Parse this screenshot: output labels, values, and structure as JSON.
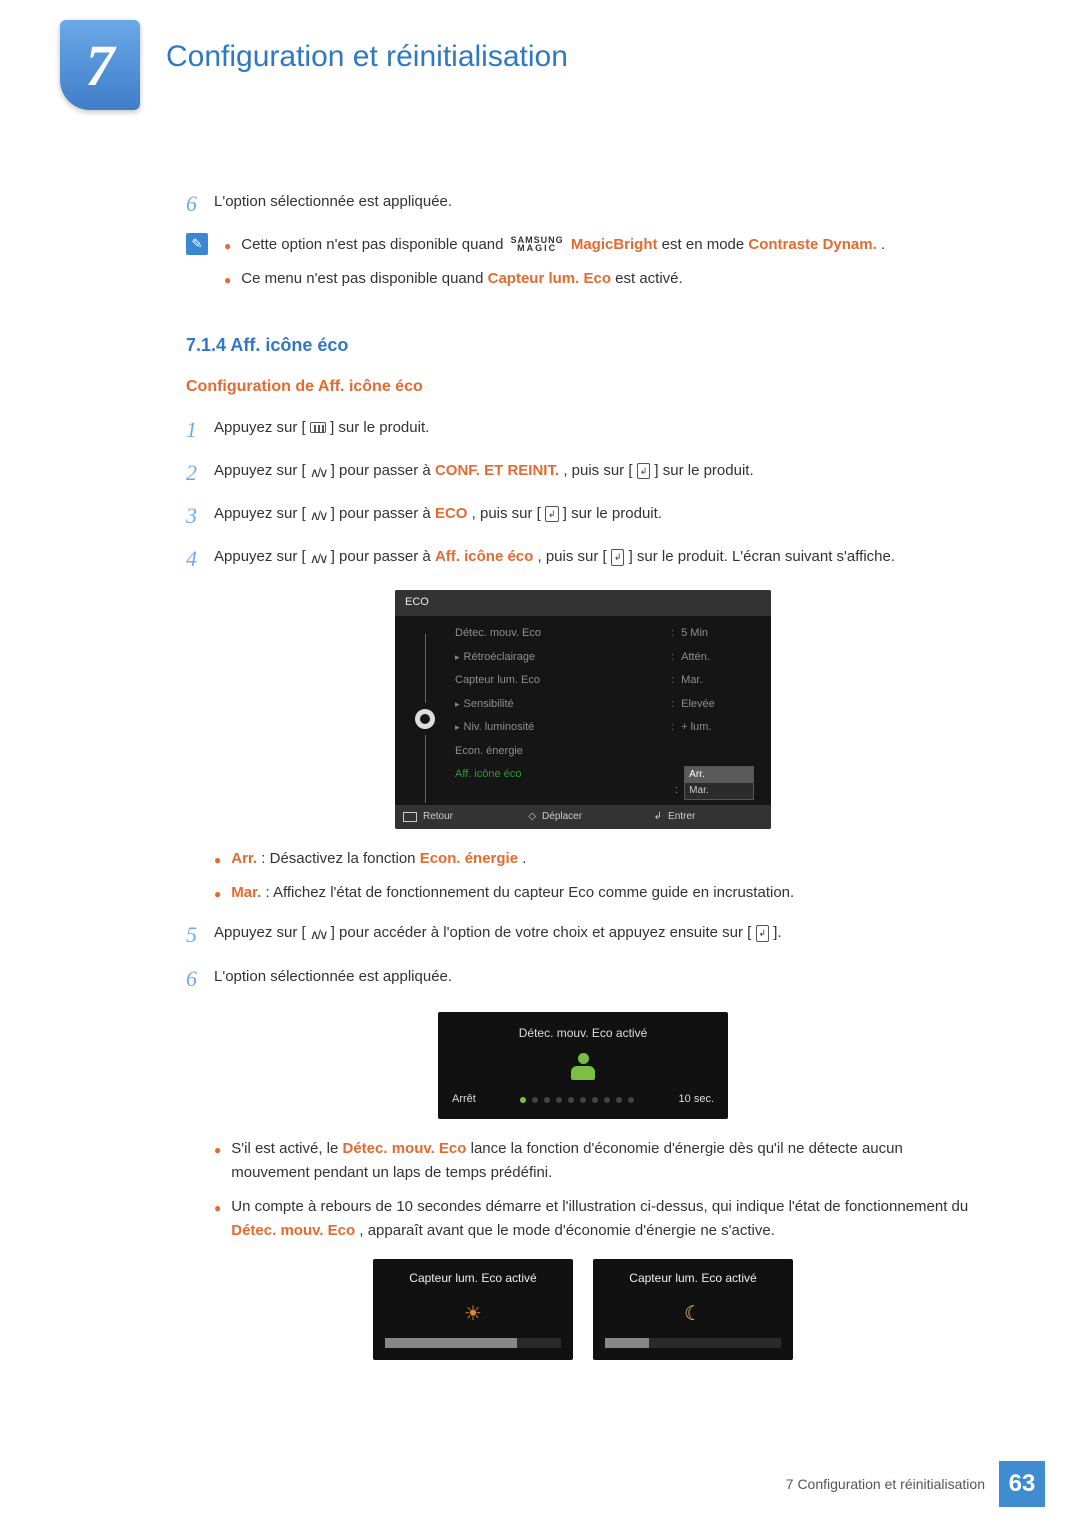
{
  "chapter": {
    "number": "7",
    "title": "Configuration et réinitialisation"
  },
  "top_step": {
    "num": "6",
    "text": "L'option sélectionnée est appliquée."
  },
  "note": {
    "bullet1_pre": "Cette option n'est pas disponible quand ",
    "bullet1_post": " est en mode ",
    "magicbright": "MagicBright",
    "dynam": "Contraste Dynam.",
    "period": ".",
    "bullet2_pre": "Ce menu n'est pas disponible quand ",
    "bullet2_hi": "Capteur lum. Eco",
    "bullet2_post": " est activé."
  },
  "magic_brand": {
    "line1": "SAMSUNG",
    "line2": "MAGIC"
  },
  "section": {
    "num_title": "7.1.4  Aff. icône éco",
    "subtitle": "Configuration de Aff. icône éco"
  },
  "steps": {
    "s1": {
      "num": "1",
      "pre": "Appuyez sur [",
      "post": "] sur le produit."
    },
    "s2": {
      "num": "2",
      "pre": "Appuyez sur [",
      "mid1": "] pour passer à ",
      "hi": "CONF. ET REINIT.",
      "mid2": ", puis sur [",
      "post": "] sur le produit."
    },
    "s3": {
      "num": "3",
      "pre": "Appuyez sur [",
      "mid1": "] pour passer à ",
      "hi": "ECO",
      "mid2": ", puis sur [",
      "post": "] sur le produit."
    },
    "s4": {
      "num": "4",
      "pre": "Appuyez sur [",
      "mid1": "] pour passer à ",
      "hi": "Aff. icône éco",
      "mid2": ", puis sur [",
      "post": "] sur le produit. L'écran suivant s'affiche."
    },
    "s5": {
      "num": "5",
      "pre": "Appuyez sur [",
      "mid": "] pour accéder à l'option de votre choix et appuyez ensuite sur [",
      "post": "]."
    },
    "s6": {
      "num": "6",
      "text": "L'option sélectionnée est appliquée."
    }
  },
  "osd": {
    "title": "ECO",
    "rows": [
      {
        "label": "Détec. mouv. Eco",
        "val": "5 Min"
      },
      {
        "label": "Rétroéclairage",
        "sub": true,
        "val": "Attén."
      },
      {
        "label": "Capteur lum. Eco",
        "val": "Mar."
      },
      {
        "label": "Sensibilité",
        "sub": true,
        "val": "Elevée"
      },
      {
        "label": "Niv. luminosité",
        "sub": true,
        "val": "+ lum."
      },
      {
        "label": "Econ. énergie",
        "val": ""
      }
    ],
    "active_label": "Aff. icône éco",
    "selected": "Arr.",
    "option2": "Mar.",
    "foot": {
      "back": "Retour",
      "move": "Déplacer",
      "enter": "Entrer"
    }
  },
  "opt_bullets": {
    "arr_hi": "Arr.",
    "arr_txt": ": Désactivez la fonction ",
    "arr_hi2": "Econ. énergie",
    "arr_end": ".",
    "mar_hi": "Mar.",
    "mar_txt": ": Affichez l'état de fonctionnement du capteur Eco comme guide en incrustation."
  },
  "overlay": {
    "title": "Détec. mouv. Eco activé",
    "left": "Arrêt",
    "right": "10 sec."
  },
  "after_bullets": {
    "b1_pre": "S'il est activé, le ",
    "b1_hi": "Détec. mouv. Eco",
    "b1_post": " lance la fonction d'économie d'énergie dès qu'il ne détecte aucun mouvement pendant un laps de temps prédéfini.",
    "b2_pre": "Un compte à rebours de 10 secondes démarre et l'illustration ci-dessus, qui indique l'état de fonctionnement du ",
    "b2_hi": "Détec. mouv. Eco",
    "b2_post": ", apparaît avant que le mode d'économie d'énergie ne s'active."
  },
  "lux_panels": {
    "title": "Capteur lum. Eco activé",
    "fills": [
      "75%",
      "25%"
    ]
  },
  "footer": {
    "text": "7 Configuration et réinitialisation",
    "page": "63"
  },
  "glyphs": {
    "updown": "∧/∨",
    "enter": "↲",
    "diamond": "◇"
  }
}
